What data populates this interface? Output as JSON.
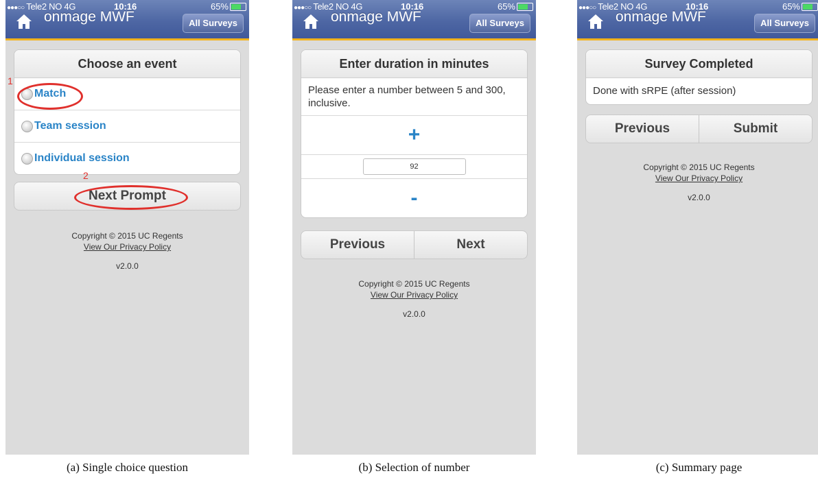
{
  "status": {
    "carrier": "Tele2 NO",
    "network": "4G",
    "time": "10:16",
    "battery": "65%"
  },
  "app": {
    "title": "onmage MWF",
    "all_surveys_label": "All Surveys"
  },
  "footer": {
    "copyright": "Copyright © 2015 UC Regents",
    "privacy": "View Our Privacy Policy",
    "version": "v2.0.0"
  },
  "screen_a": {
    "title": "Choose an event",
    "options": [
      "Match",
      "Team session",
      "Individual session"
    ],
    "next_label": "Next Prompt",
    "annotations": [
      "1",
      "2"
    ],
    "caption": "(a) Single choice question"
  },
  "screen_b": {
    "title": "Enter duration in minutes",
    "description": "Please enter a number between 5 and 300, inclusive.",
    "plus_label": "+",
    "minus_label": "-",
    "value": "92",
    "previous_label": "Previous",
    "next_label": "Next",
    "caption": "(b) Selection of number"
  },
  "screen_c": {
    "title": "Survey Completed",
    "message": "Done with sRPE (after session)",
    "previous_label": "Previous",
    "submit_label": "Submit",
    "caption": "(c) Summary page"
  },
  "colors": {
    "header": "#4e67a4",
    "accent_stripe": "#f3b21c",
    "link": "#2a84c7",
    "annotation": "#e0302c"
  }
}
